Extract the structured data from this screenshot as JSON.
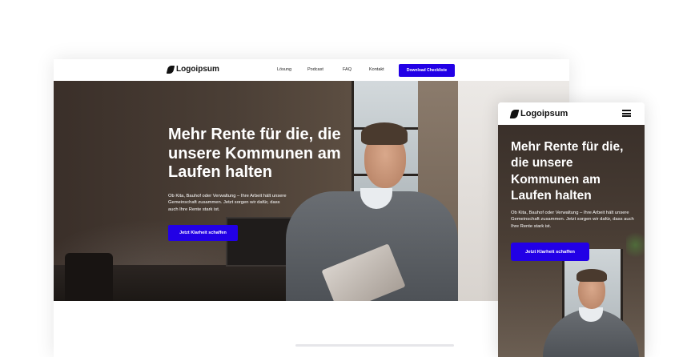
{
  "brand": {
    "logo_text": "Logoipsum",
    "accent": "#2200e6"
  },
  "desktop": {
    "nav": {
      "links": [
        "Lösung",
        "Podcast",
        "FAQ",
        "Kontakt"
      ],
      "cta_label": "Download Checkliste"
    },
    "hero": {
      "title": "Mehr Rente für die, die unsere Kommunen am Laufen halten",
      "subtitle": "Ob Kita, Bauhof oder Verwaltung – Ihre Arbeit hält unsere Gemeinschaft zusammen. Jetzt sorgen wir dafür, dass auch Ihre Rente stark ist.",
      "button_label": "Jetzt Klarheit schaffen"
    }
  },
  "mobile": {
    "nav": {
      "menu_icon": "hamburger-menu-icon"
    },
    "hero": {
      "title": "Mehr Rente für die, die unsere Kommunen am Laufen halten",
      "subtitle": "Ob Kita, Bauhof oder Verwaltung – Ihre Arbeit hält unsere Gemeinschaft zusammen. Jetzt sorgen wir dafür, dass auch Ihre Rente stark ist.",
      "button_label": "Jetzt Klarheit schaffen"
    }
  }
}
